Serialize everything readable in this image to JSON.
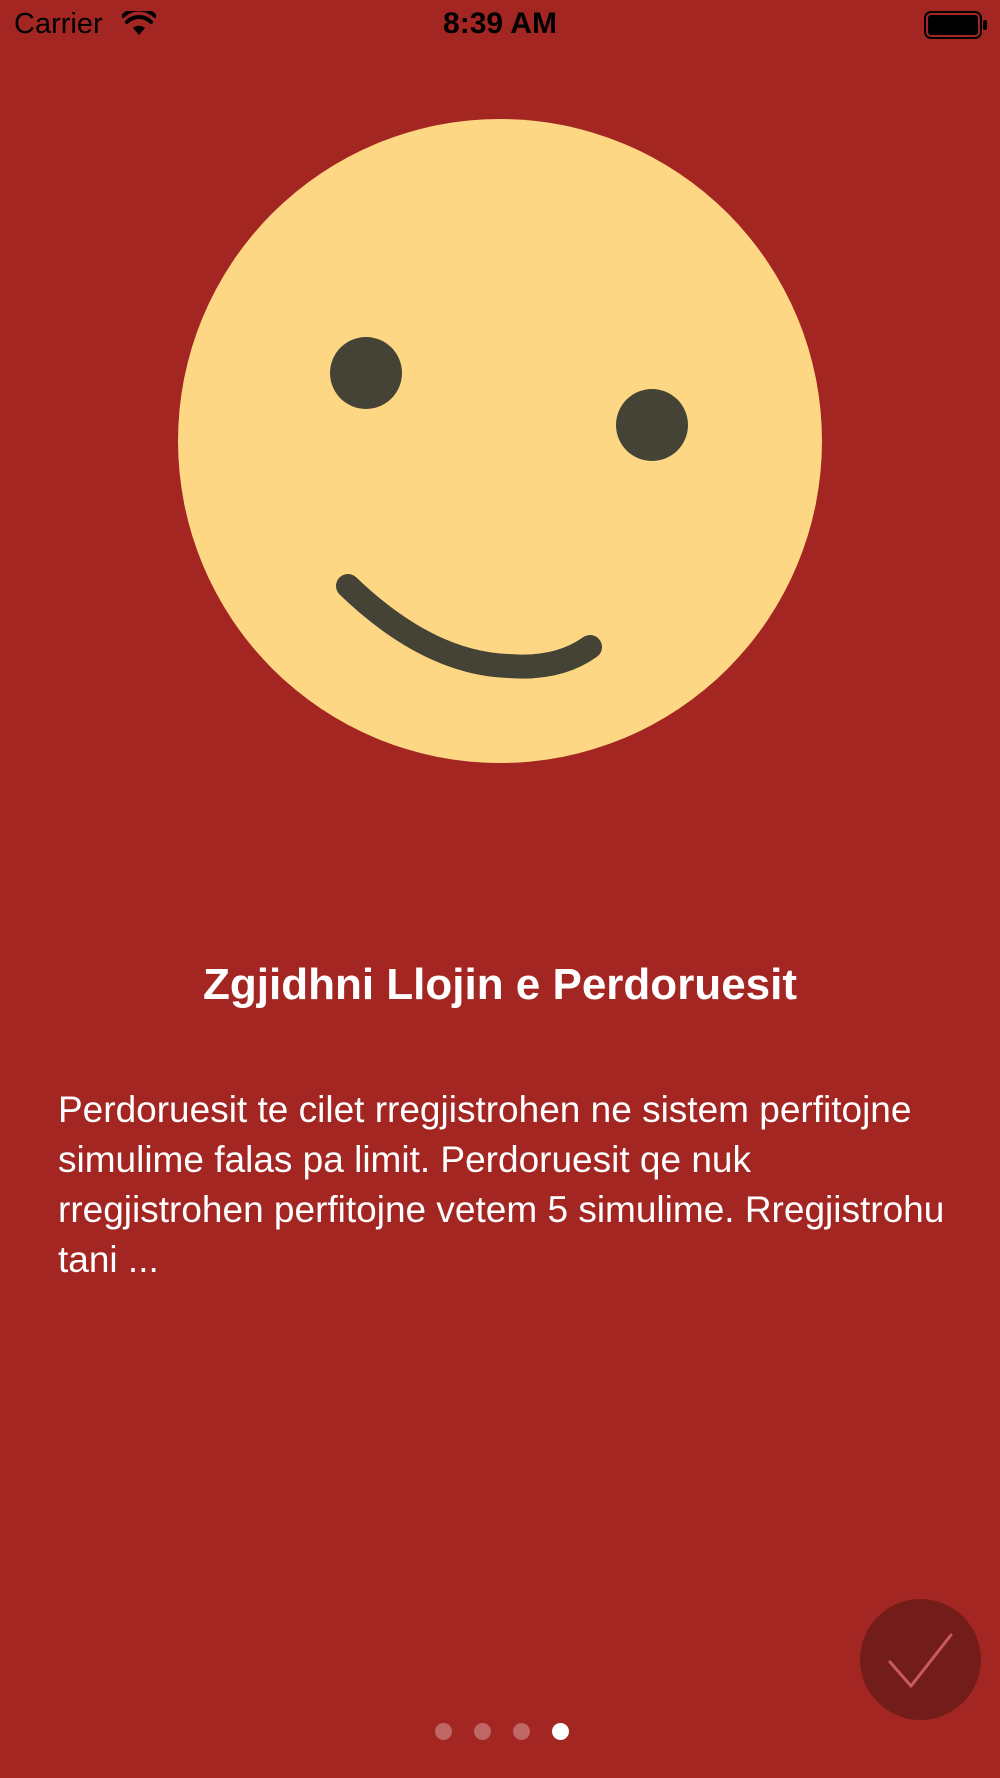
{
  "status_bar": {
    "carrier": "Carrier",
    "time": "8:39 AM",
    "icons": [
      "wifi-icon",
      "battery-icon"
    ]
  },
  "onboarding": {
    "illustration": "smiley-face-illustration",
    "title": "Zgjidhni Llojin e Perdoruesit",
    "description": "Perdoruesit te cilet rregjistrohen ne sistem perfitojne simulime falas pa limit. Perdoruesit qe nuk rregjistrohen perfitojne vetem 5 simulime. Rregjistrohu tani ...",
    "page_count": 4,
    "current_page": 4,
    "done_icon": "checkmark-icon"
  },
  "colors": {
    "background": "#A32622",
    "face": "#FDD783",
    "face_features": "#454336",
    "done_button": "#731D1B",
    "checkmark": "#C95A5E"
  }
}
